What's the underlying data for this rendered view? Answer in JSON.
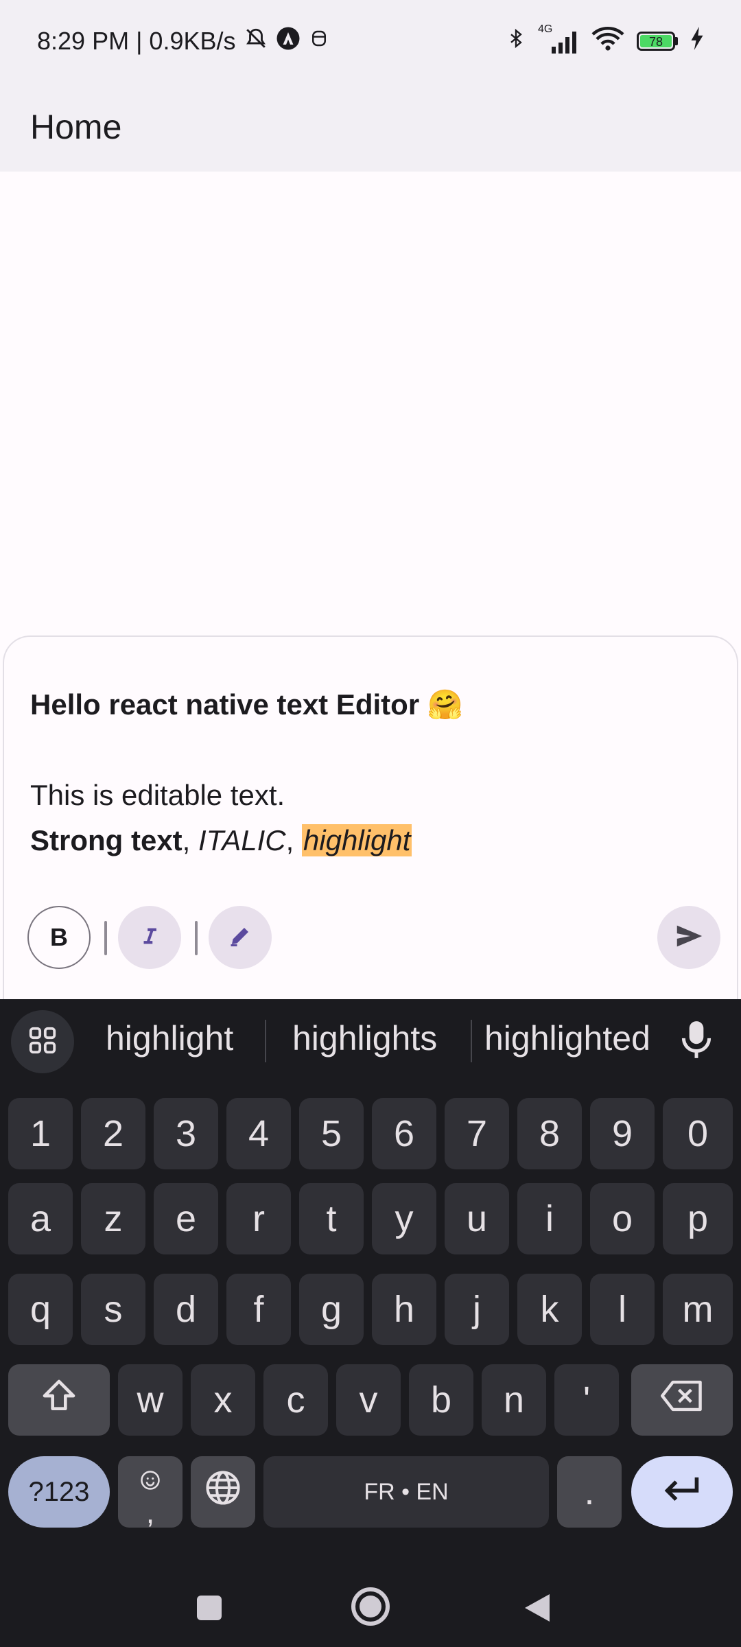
{
  "status": {
    "time_speed": "8:29 PM | 0.9KB/s",
    "network": "4G",
    "battery": "78"
  },
  "app": {
    "title": "Home"
  },
  "editor": {
    "title_line": "Hello react native text Editor 🤗",
    "line2": "This is editable text.",
    "strong": "Strong text",
    "sep1": ", ",
    "italic": "ITALIC",
    "sep2": ", ",
    "highlight": "highlight"
  },
  "toolbar": {
    "bold_label": "B",
    "italic_icon": "italic-icon",
    "highlight_icon": "pen-icon",
    "send_icon": "send-icon"
  },
  "keyboard": {
    "suggestions": [
      "highlight",
      "highlights",
      "highlighted"
    ],
    "row_numbers": [
      "1",
      "2",
      "3",
      "4",
      "5",
      "6",
      "7",
      "8",
      "9",
      "0"
    ],
    "row1": [
      "a",
      "z",
      "e",
      "r",
      "t",
      "y",
      "u",
      "i",
      "o",
      "p"
    ],
    "row2": [
      "q",
      "s",
      "d",
      "f",
      "g",
      "h",
      "j",
      "k",
      "l",
      "m"
    ],
    "row3": [
      "w",
      "x",
      "c",
      "v",
      "b",
      "n",
      "'"
    ],
    "sym_label": "?123",
    "comma_label": ",",
    "space_label": "FR • EN",
    "period_label": "."
  },
  "colors": {
    "highlight": "#ffc06a",
    "accent": "#5b4a9e",
    "keyboard_bg": "#1b1b1f"
  }
}
